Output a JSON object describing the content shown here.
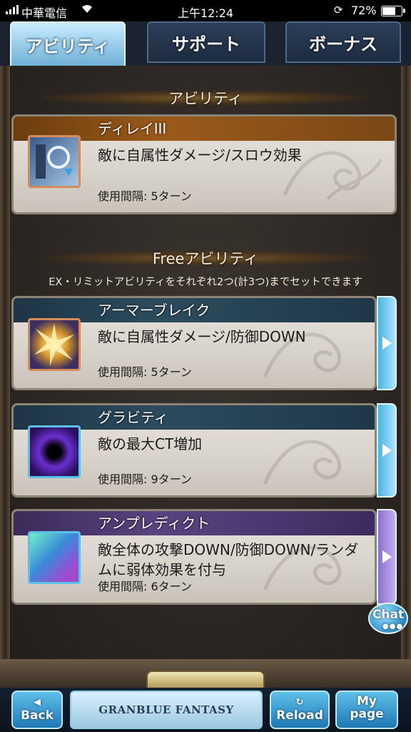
{
  "status_bar": {
    "carrier": "中華電信",
    "time": "上午12:24",
    "battery_percent": "72%"
  },
  "tabs": [
    {
      "label": "アビリティ",
      "active": true
    },
    {
      "label": "サポート",
      "active": false
    },
    {
      "label": "ボーナス",
      "active": false
    }
  ],
  "ability_section": {
    "title": "アビリティ",
    "card": {
      "name": "ディレイIII",
      "description": "敵に自属性ダメージ/スロウ効果",
      "interval": "使用間隔: 5ターン",
      "icon": "delay-hourglass-icon"
    }
  },
  "free_section": {
    "title": "Freeアビリティ",
    "note": "EX・リミットアビリティをそれぞれ2つ(計3つ)までセットできます",
    "cards": [
      {
        "name": "アーマーブレイク",
        "description": "敵に自属性ダメージ/防御DOWN",
        "interval": "使用間隔: 5ターン",
        "icon": "armor-break-icon",
        "bar_color": "#2c4c5e"
      },
      {
        "name": "グラビティ",
        "description": "敵の最大CT増加",
        "interval": "使用間隔: 9ターン",
        "icon": "gravity-orb-icon",
        "bar_color": "#2c4c5e"
      },
      {
        "name": "アンプレディクト",
        "description": "敵全体の攻撃DOWN/防御DOWN/ランダムに弱体効果を付与",
        "interval": "使用間隔: 6ターン",
        "icon": "unpredict-hand-icon",
        "bar_color": "#5a4480"
      }
    ]
  },
  "chat_button": {
    "label": "Chat"
  },
  "bottom_nav": {
    "back": "Back",
    "logo_text": "GRANBLUE FANTASY",
    "reload": "Reload",
    "mypage_line1": "My",
    "mypage_line2": "page"
  }
}
